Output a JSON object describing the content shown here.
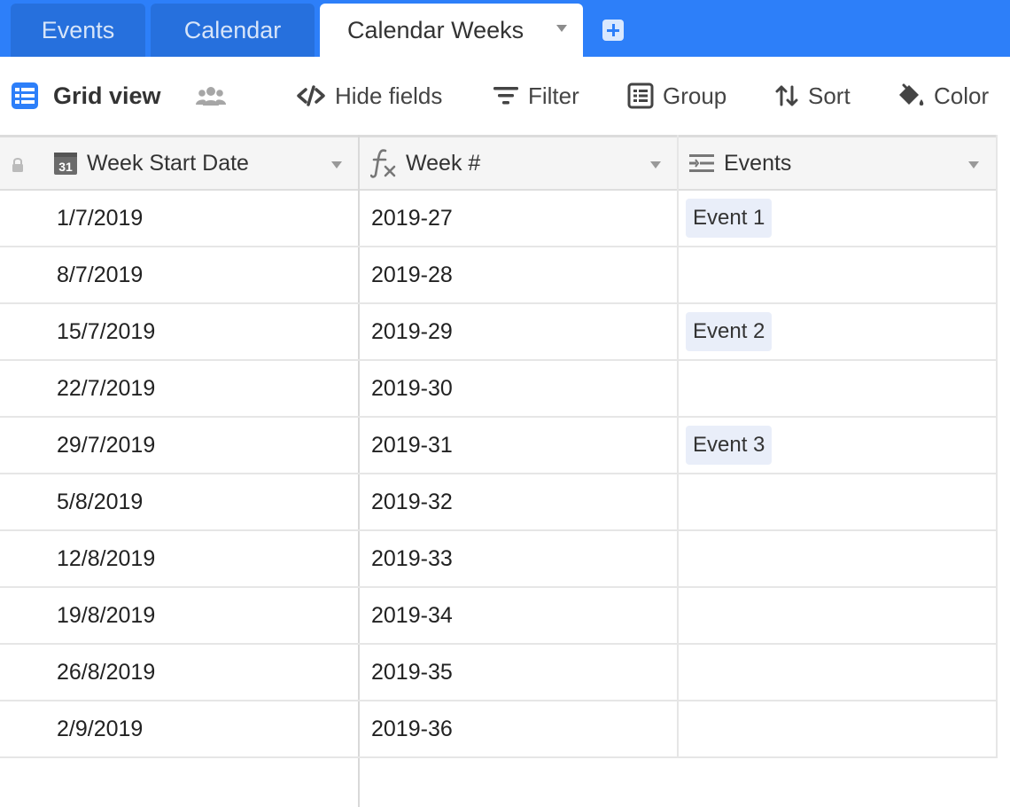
{
  "tabs": [
    {
      "label": "Events"
    },
    {
      "label": "Calendar"
    },
    {
      "label": "Calendar Weeks"
    }
  ],
  "toolbar": {
    "view_name": "Grid view",
    "hide_fields": "Hide fields",
    "filter": "Filter",
    "group": "Group",
    "sort": "Sort",
    "color": "Color"
  },
  "columns": [
    {
      "name": "Week Start Date",
      "icon": "date-field-icon",
      "icon_text": "31"
    },
    {
      "name": "Week #",
      "icon": "formula-field-icon"
    },
    {
      "name": "Events",
      "icon": "linked-record-field-icon"
    }
  ],
  "rows": [
    {
      "date": "1/7/2019",
      "week": "2019-27",
      "event": "Event 1"
    },
    {
      "date": "8/7/2019",
      "week": "2019-28",
      "event": ""
    },
    {
      "date": "15/7/2019",
      "week": "2019-29",
      "event": "Event 2"
    },
    {
      "date": "22/7/2019",
      "week": "2019-30",
      "event": ""
    },
    {
      "date": "29/7/2019",
      "week": "2019-31",
      "event": "Event 3"
    },
    {
      "date": "5/8/2019",
      "week": "2019-32",
      "event": ""
    },
    {
      "date": "12/8/2019",
      "week": "2019-33",
      "event": ""
    },
    {
      "date": "19/8/2019",
      "week": "2019-34",
      "event": ""
    },
    {
      "date": "26/8/2019",
      "week": "2019-35",
      "event": ""
    },
    {
      "date": "2/9/2019",
      "week": "2019-36",
      "event": ""
    }
  ],
  "colors": {
    "tabbar": "#2d7ff9",
    "tab_inactive": "#2670dd",
    "accent_icon": "#2d7ff9",
    "event_pill": "#e9eef9",
    "header_bg": "#f5f5f5"
  }
}
